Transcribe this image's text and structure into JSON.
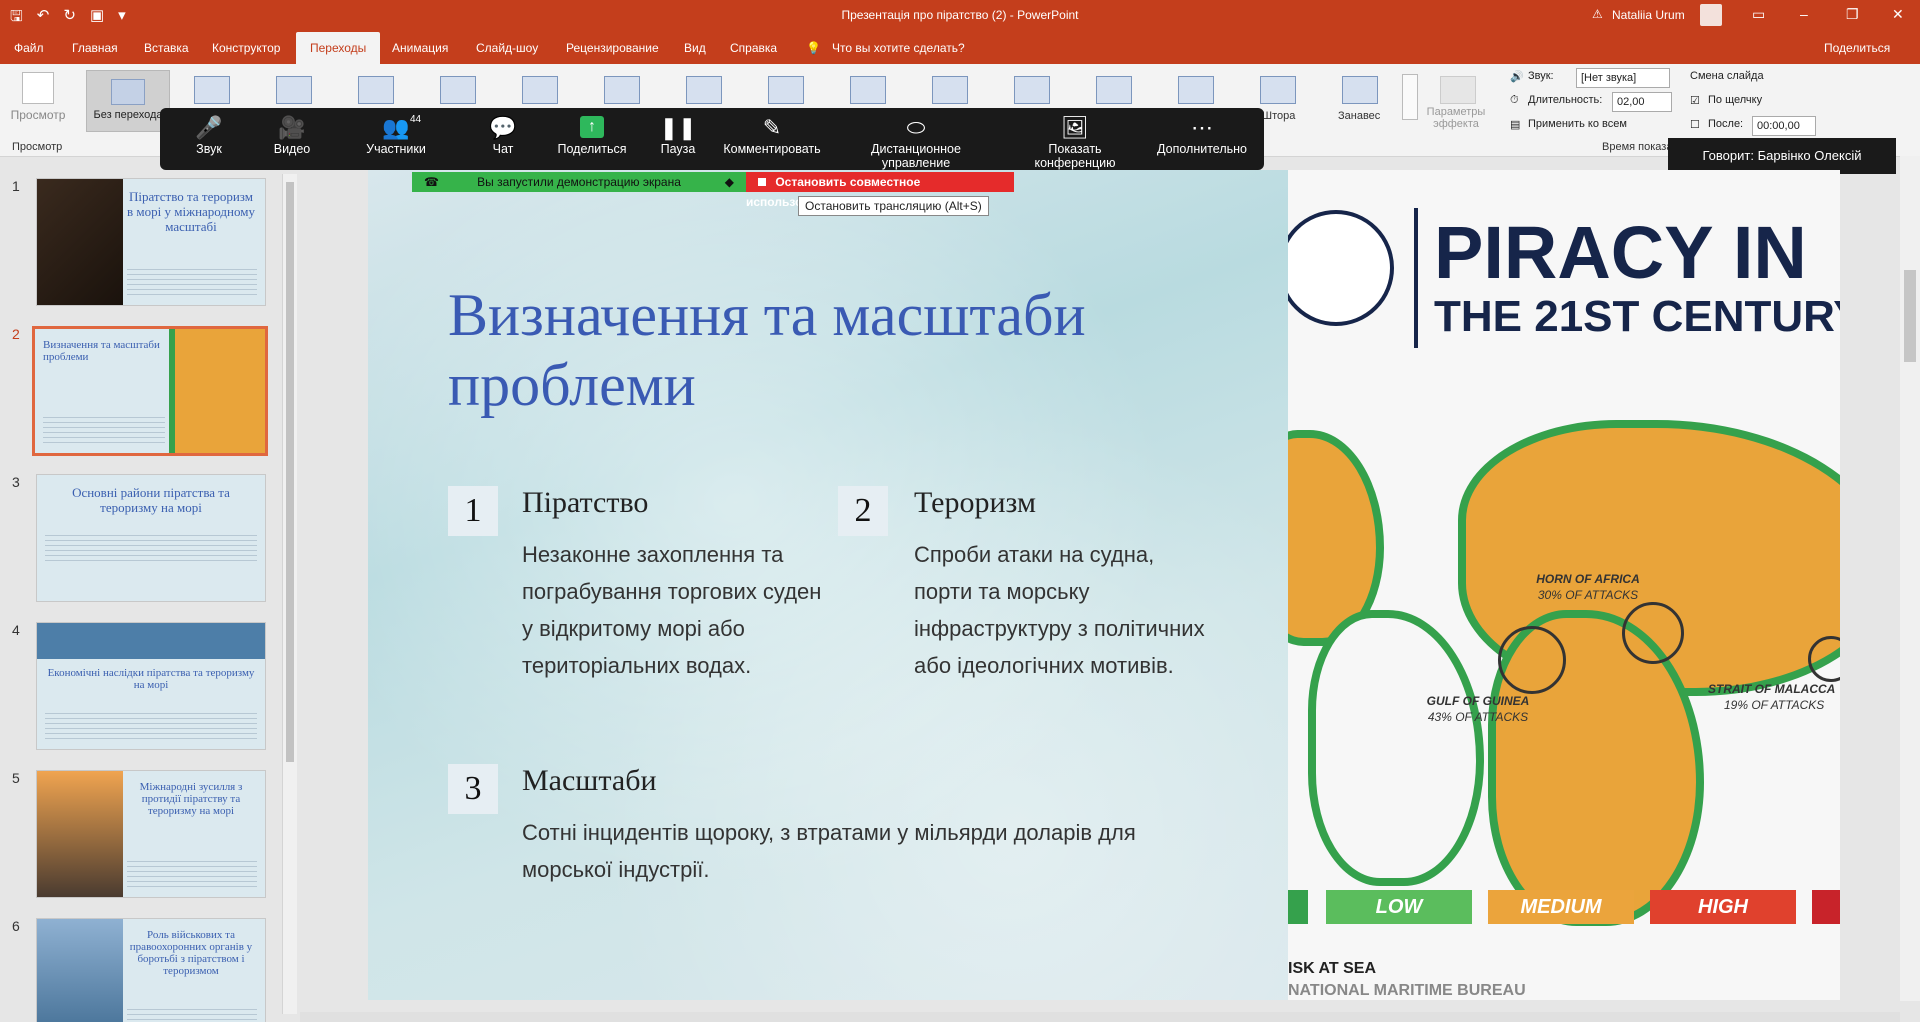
{
  "app": {
    "title": "Презентація про піратство (2)  -  PowerPoint",
    "user": "Nataliia Urum",
    "brand_color": "#c43e1c"
  },
  "menu": {
    "items": [
      "Файл",
      "Главная",
      "Вставка",
      "Конструктор",
      "Переходы",
      "Анимация",
      "Слайд-шоу",
      "Рецензирование",
      "Вид",
      "Справка"
    ],
    "active": "Переходы",
    "tell_me": "Что вы хотите сделать?",
    "share": "Поделиться"
  },
  "ribbon": {
    "preview": "Просмотр",
    "preview_group": "Просмотр",
    "none": "Без перехода",
    "shtora": "Штора",
    "curtain": "Занавес",
    "effect_params": "Параметры эффекта",
    "sound_label": "Звук:",
    "sound_value": "[Нет звука]",
    "duration_label": "Длительность:",
    "duration_value": "02,00",
    "apply_all": "Применить ко всем",
    "advance_label": "Смена слайда",
    "on_click": "По щелчку",
    "after": "После:",
    "after_value": "00:00,00",
    "timing_group": "Время показа"
  },
  "zoom": {
    "buttons": [
      "Звук",
      "Видео",
      "Участники",
      "Чат",
      "Поделиться",
      "Пауза",
      "Комментировать",
      "Дистанционное управление",
      "Показать конференцию",
      "Дополнительно"
    ],
    "participants_count": "44",
    "speaker": "Говорит: Барвінко Олексій",
    "share_status": "Вы запустили демонстрацию экрана",
    "stop_share": "Остановить совместное использование",
    "stop_tooltip": "Остановить трансляцию (Alt+S)",
    "share_color": "#2eb85c",
    "stop_color": "#e52b2b"
  },
  "thumbnails": [
    {
      "num": "1",
      "title": "Піратство та тероризм в морі у міжнародному масштабі"
    },
    {
      "num": "2",
      "title": "Визначення та масштаби проблеми",
      "selected": true
    },
    {
      "num": "3",
      "title": "Основні райони піратства та тероризму на морі"
    },
    {
      "num": "4",
      "title": "Економічні наслідки піратства та тероризму на морі"
    },
    {
      "num": "5",
      "title": "Міжнародні зусилля з протидії піратству та тероризму на морі"
    },
    {
      "num": "6",
      "title": "Роль військових та правоохоронних органів у боротьбі з піратством і тероризмом"
    }
  ],
  "slide": {
    "title": "Визначення та масштаби проблеми",
    "items": [
      {
        "num": "1",
        "title": "Піратство",
        "text": "Незаконне захоплення та пограбування торгових суден у відкритому морі або територіальних водах."
      },
      {
        "num": "2",
        "title": "Тероризм",
        "text": "Спроби атаки на судна, порти та морську інфраструктуру з політичних або ідеологічних мотивів."
      },
      {
        "num": "3",
        "title": "Масштаби",
        "text": "Сотні інцидентів щороку, з втратами у мільярди доларів для морської індустрії."
      }
    ],
    "title_color": "#3a5ab3",
    "map": {
      "header1": "PIRACY IN",
      "header2": "THE 21ST CENTURY",
      "horn": "HORN OF AFRICA",
      "horn_pct": "30% OF ATTACKS",
      "guinea": "GULF OF GUINEA",
      "guinea_pct": "43% OF ATTACKS",
      "malacca": "STRAIT OF MALACCA",
      "malacca_pct": "19% OF ATTACKS",
      "legend": [
        "LOW",
        "MEDIUM",
        "HIGH"
      ],
      "foot1": "ISK AT SEA",
      "foot2": "NATIONAL MARITIME BUREAU"
    }
  }
}
